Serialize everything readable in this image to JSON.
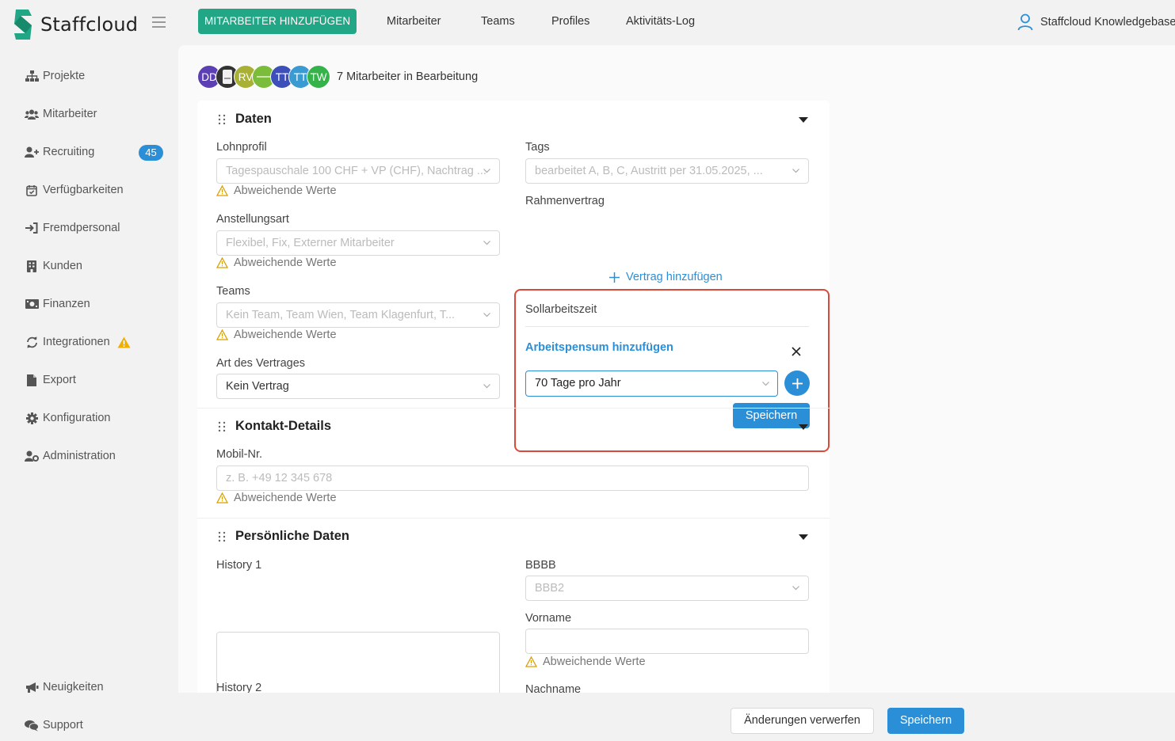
{
  "app": {
    "name": "Staffcloud",
    "brand_color": "#21a785",
    "accent_color": "#2b8fd8"
  },
  "topnav": {
    "add_button": "MITARBEITER HINZUFÜGEN",
    "links": [
      "Mitarbeiter",
      "Teams",
      "Profiles",
      "Aktivitäts-Log"
    ],
    "user": "Staffcloud Knowledgebase"
  },
  "sidebar": {
    "items": [
      {
        "label": "Projekte",
        "icon": "sitemap-icon"
      },
      {
        "label": "Mitarbeiter",
        "icon": "users-icon"
      },
      {
        "label": "Recruiting",
        "icon": "user-plus-icon",
        "badge": "45"
      },
      {
        "label": "Verfügbarkeiten",
        "icon": "calendar-check-icon"
      },
      {
        "label": "Fremdpersonal",
        "icon": "sign-in-icon"
      },
      {
        "label": "Kunden",
        "icon": "building-icon"
      },
      {
        "label": "Finanzen",
        "icon": "money-icon"
      },
      {
        "label": "Integrationen",
        "icon": "sync-icon",
        "warning": true
      },
      {
        "label": "Export",
        "icon": "file-icon"
      },
      {
        "label": "Konfiguration",
        "icon": "gear-icon"
      },
      {
        "label": "Administration",
        "icon": "user-cog-icon"
      }
    ],
    "bottom": [
      {
        "label": "Neuigkeiten",
        "icon": "megaphone-icon"
      },
      {
        "label": "Support",
        "icon": "comments-icon"
      }
    ]
  },
  "editing": {
    "avatars": [
      {
        "initials": "DD",
        "color": "#5b3fb3"
      },
      {
        "initials": "",
        "color": "#333333"
      },
      {
        "initials": "RV",
        "color": "#a8b035"
      },
      {
        "initials": "",
        "color": "#7bbd3a"
      },
      {
        "initials": "TT",
        "color": "#3d4fb8"
      },
      {
        "initials": "TT",
        "color": "#3a9bd2"
      },
      {
        "initials": "TW",
        "color": "#36b24a"
      }
    ],
    "summary": "7 Mitarbeiter in Bearbeitung"
  },
  "sections": {
    "daten": {
      "title": "Daten",
      "lohnprofil": {
        "label": "Lohnprofil",
        "value": "Tagespauschale 100 CHF + VP (CHF), Nachtrag ..."
      },
      "anstellungsart": {
        "label": "Anstellungsart",
        "value": "Flexibel, Fix, Externer Mitarbeiter"
      },
      "teams": {
        "label": "Teams",
        "value": "Kein Team, Team Wien, Team Klagenfurt, T..."
      },
      "vertragsart": {
        "label": "Art des Vertrages",
        "value": "Kein Vertrag"
      },
      "tags": {
        "label": "Tags",
        "value": "bearbeitet A, B, C, Austritt per 31.05.2025, ..."
      },
      "rahmenvertrag": {
        "label": "Rahmenvertrag",
        "add_link": "Vertrag hinzufügen"
      },
      "sollarbeitszeit": {
        "label": "Sollarbeitszeit",
        "pensum_link": "Arbeitspensum hinzufügen",
        "selected": "70 Tage pro Jahr",
        "save": "Speichern"
      },
      "warning": "Abweichende Werte"
    },
    "kontakt": {
      "title": "Kontakt-Details",
      "mobil": {
        "label": "Mobil-Nr.",
        "placeholder": "z. B. +49 12 345 678"
      },
      "warning": "Abweichende Werte"
    },
    "persoenlich": {
      "title": "Persönliche Daten",
      "history1": "History 1",
      "history2": "History 2",
      "bbbb": {
        "label": "BBBB",
        "value": "BBB2"
      },
      "vorname": "Vorname",
      "nachname": "Nachname",
      "warning": "Abweichende Werte"
    }
  },
  "footer": {
    "discard": "Änderungen verwerfen",
    "save": "Speichern"
  }
}
